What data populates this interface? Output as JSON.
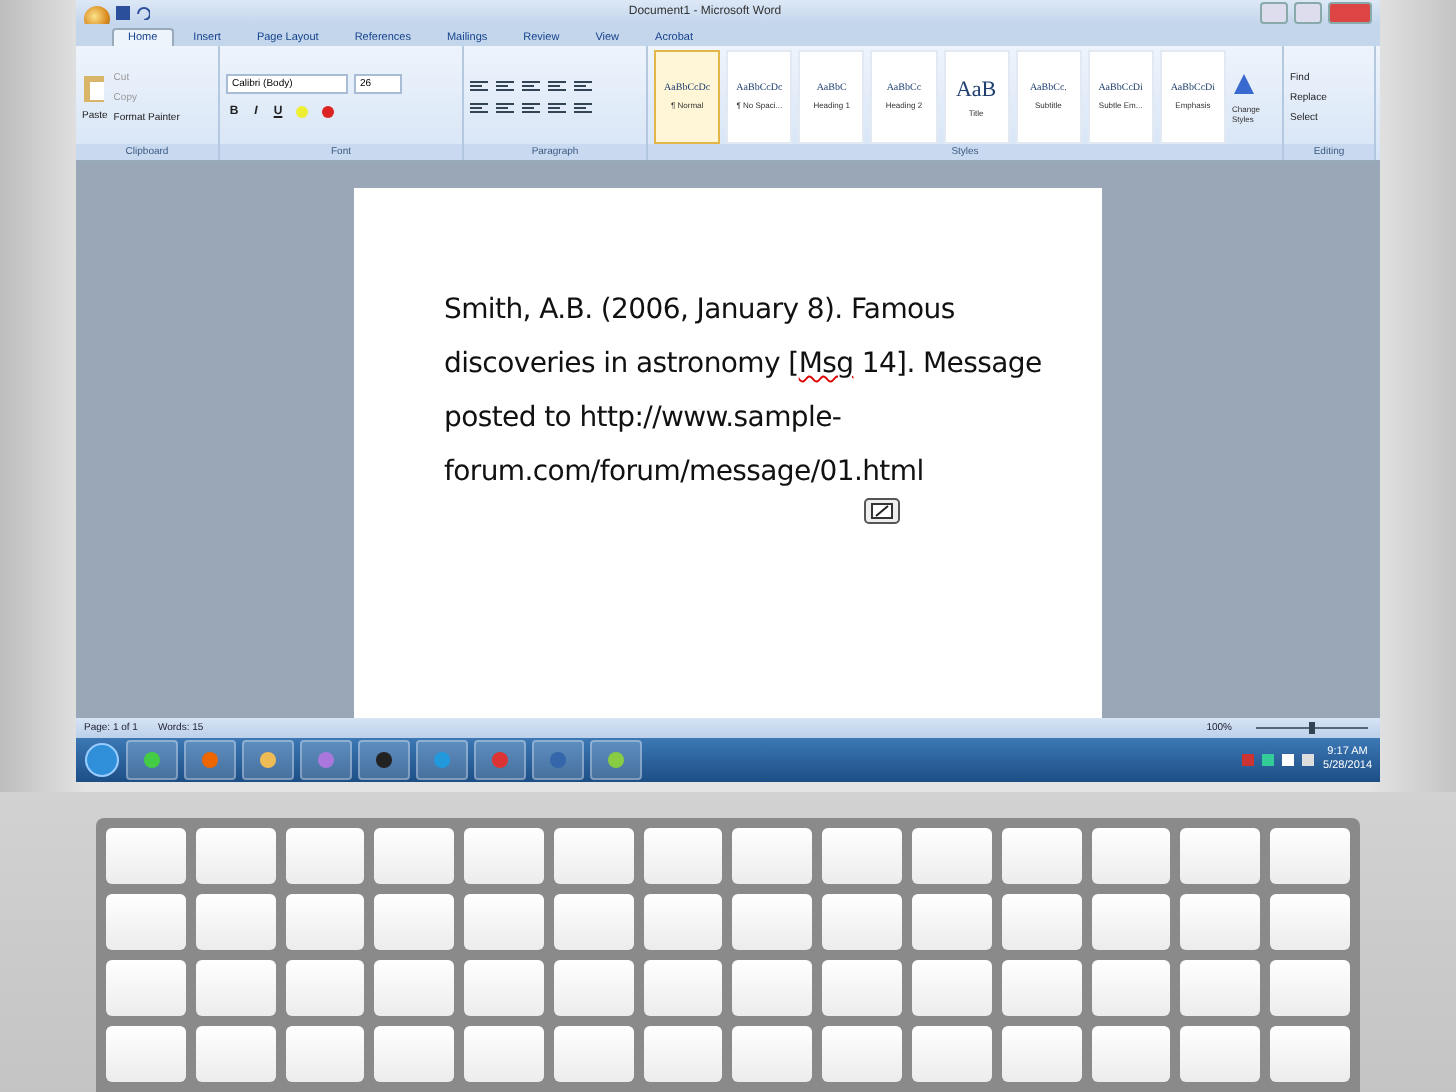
{
  "window": {
    "title": "Document1 - Microsoft Word"
  },
  "tabs": [
    {
      "label": "Home",
      "selected": true
    },
    {
      "label": "Insert",
      "selected": false
    },
    {
      "label": "Page Layout",
      "selected": false
    },
    {
      "label": "References",
      "selected": false
    },
    {
      "label": "Mailings",
      "selected": false
    },
    {
      "label": "Review",
      "selected": false
    },
    {
      "label": "View",
      "selected": false
    },
    {
      "label": "Acrobat",
      "selected": false
    }
  ],
  "clipboard": {
    "paste": "Paste",
    "items": [
      {
        "label": "Cut",
        "disabled": true
      },
      {
        "label": "Copy",
        "disabled": true
      },
      {
        "label": "Format Painter",
        "disabled": false
      }
    ],
    "group": "Clipboard"
  },
  "font": {
    "name": "Calibri (Body)",
    "size": "26",
    "format_buttons": [
      "B",
      "I",
      "U"
    ],
    "group": "Font"
  },
  "paragraph": {
    "group": "Paragraph"
  },
  "styles": {
    "items": [
      {
        "preview": "AaBbCcDc",
        "label": "¶ Normal",
        "selected": true
      },
      {
        "preview": "AaBbCcDc",
        "label": "¶ No Spaci...",
        "selected": false
      },
      {
        "preview": "AaBbC",
        "label": "Heading 1",
        "selected": false
      },
      {
        "preview": "AaBbCc",
        "label": "Heading 2",
        "selected": false
      },
      {
        "preview": "AaB",
        "label": "Title",
        "selected": false
      },
      {
        "preview": "AaBbCc.",
        "label": "Subtitle",
        "selected": false
      },
      {
        "preview": "AaBbCcDi",
        "label": "Subtle Em...",
        "selected": false
      },
      {
        "preview": "AaBbCcDi",
        "label": "Emphasis",
        "selected": false
      }
    ],
    "change_styles": "Change Styles",
    "group": "Styles"
  },
  "editing": {
    "items": [
      "Find",
      "Replace",
      "Select"
    ],
    "group": "Editing"
  },
  "document": {
    "segments": [
      {
        "kind": "normal",
        "text": "Smith, A.B. (2006, January 8). Famous discoveries in astronomy ["
      },
      {
        "kind": "misspelled",
        "text": "Msg"
      },
      {
        "kind": "normal",
        "text": " 14]. Message posted to http://www.sample-forum.com/forum/message/01.html"
      }
    ]
  },
  "status_bar": {
    "page": "Page: 1 of 1",
    "words": "Words: 15",
    "zoom": "100%",
    "zoom_slider": {
      "level": 0.5
    }
  },
  "taskbar": {
    "time": "9:17 AM",
    "date": "5/28/2014"
  }
}
